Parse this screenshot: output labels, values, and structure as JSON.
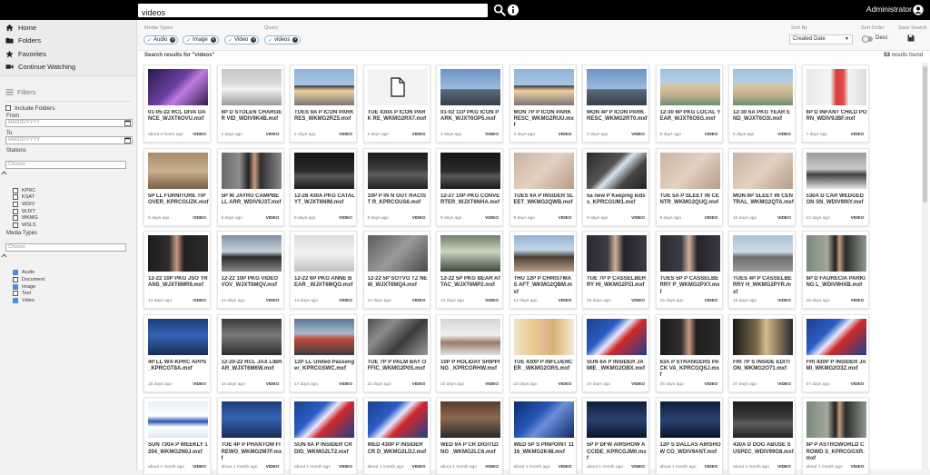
{
  "search": {
    "value": "videos"
  },
  "user": {
    "name": "Administrator"
  },
  "nav": [
    {
      "label": "Home",
      "icon": "home-icon"
    },
    {
      "label": "Folders",
      "icon": "folder-icon"
    },
    {
      "label": "Favorites",
      "icon": "star-icon"
    },
    {
      "label": "Continue Watching",
      "icon": "video-camera-icon"
    }
  ],
  "filters": {
    "title": "Filters",
    "include_folders": "Include Folders",
    "from_label": "From",
    "from_placeholder": "MM/DD/YYYY",
    "to_label": "To",
    "to_placeholder": "MM/DD/YYYY",
    "stations_label": "Stations",
    "stations_placeholder": "Choose",
    "stations": [
      "KPRC",
      "KSAT",
      "WDIV",
      "WJXT",
      "WKMG",
      "WSLS"
    ],
    "media_types_label": "Media Types",
    "media_types_placeholder": "Choose",
    "media_types": [
      {
        "label": "Audio",
        "checked": true
      },
      {
        "label": "Document",
        "checked": false
      },
      {
        "label": "Image",
        "checked": true
      },
      {
        "label": "Text",
        "checked": false
      },
      {
        "label": "Video",
        "checked": true
      }
    ]
  },
  "filterbar": {
    "media_types_label": "Media Types",
    "query_label": "Query",
    "chips": [
      "Audio",
      "Image",
      "Video"
    ],
    "query_chip": "videos",
    "sort_by_label": "Sort By",
    "sort_by_value": "Created Date",
    "sort_order_label": "Sort Order",
    "sort_order_value": "Desc",
    "save_search_label": "Save Search"
  },
  "results": {
    "heading": "Search results for \"videos\"",
    "count": "53",
    "count_suffix": "results found"
  },
  "cards": [
    {
      "title": "01-05-22 RCL DIVA DANCE_WJXT6OVU.mxf",
      "age": "about 2 hours ago",
      "type": "VIDEO",
      "thumb": "purple"
    },
    {
      "title": "6P D STOLEN CHARGER VID_WDIV9K4B.mxf",
      "age": "2 days ago",
      "type": "VIDEO",
      "thumb": "car-white"
    },
    {
      "title": "TUES 9A P ICON PARK RES_WKMG2RZ5.mxf",
      "age": "2 days ago",
      "type": "VIDEO",
      "thumb": "reporter-sky"
    },
    {
      "title": "TUE 430A P ICON PARK RE_WKMG2RX7.mxf",
      "age": "2 days ago",
      "type": "VIDEO",
      "thumb": "doc"
    },
    {
      "title": "01-02 11P PKG ICON PARK_WJXT6OP5.mxf",
      "age": "3 days ago",
      "type": "VIDEO",
      "thumb": "wheel"
    },
    {
      "title": "MON 7P P ICON PARK RESC_WKMG2RUU.mxf",
      "age": "3 days ago",
      "type": "VIDEO",
      "thumb": "reporter-sky"
    },
    {
      "title": "MON 4P P ICON PARK RESC_WKMG2RT0.mxf",
      "age": "3 days ago",
      "type": "VIDEO",
      "thumb": "wheel"
    },
    {
      "title": "12-30 6P PKG LOCAL YEAR_WJXT6O5G.mxf",
      "age": "5 days ago",
      "type": "VIDEO",
      "thumb": "buildings"
    },
    {
      "title": "12-30 6A PKG YEAR END_WJXT6O3I.mxf",
      "age": "5 days ago",
      "type": "VIDEO",
      "thumb": "buildings"
    },
    {
      "title": "6P D INFANT CHILD PORN_WDIV9JBF.mxf",
      "age": "7 days ago",
      "type": "VIDEO",
      "thumb": "red-person"
    },
    {
      "title": "5P LL FURNITURE TIPOVER_KPRCGUZK.mxf",
      "age": "8 days ago",
      "type": "VIDEO",
      "thumb": "furniture"
    },
    {
      "title": "5P W JAYRU CAMPBELL ARR_WDIV9J3T.mxf",
      "age": "8 days ago",
      "type": "VIDEO",
      "thumb": "woman-street"
    },
    {
      "title": "12-28 430A PKG CATALYT_WJXT6NIM.mxf",
      "age": "8 days ago",
      "type": "VIDEO",
      "thumb": "night-car"
    },
    {
      "title": "10P P IN N OUT RACIST R_KPRCGUS6.mxf",
      "age": "8 days ago",
      "type": "VIDEO",
      "thumb": "night-people"
    },
    {
      "title": "12-27 10P PKG CONVERTER_WJXT6NHA.mxf",
      "age": "9 days ago",
      "type": "VIDEO",
      "thumb": "night-car"
    },
    {
      "title": "TUES 9A P INSIDER SLEET_WKMG2QWB.mxf",
      "age": "9 days ago",
      "type": "VIDEO",
      "thumb": "blur-skin"
    },
    {
      "title": "5a new P Keeping kids s_KPRCGUM1.mxf",
      "age": "9 days ago",
      "type": "VIDEO",
      "thumb": "phone"
    },
    {
      "title": "TUE 5A P SLEET IN CENTR_WKMG2QUQ.mxf",
      "age": "9 days ago",
      "type": "VIDEO",
      "thumb": "blur-skin"
    },
    {
      "title": "MON 6P SLEET IN CENTRAL_WKMG2QTA.mxf",
      "age": "10 days ago",
      "type": "VIDEO",
      "thumb": "blur-skin"
    },
    {
      "title": "530A D CAR WEDGED ON SN_WDIV9INY.mxf",
      "age": "13 days ago",
      "type": "VIDEO",
      "thumb": "snow-car"
    },
    {
      "title": "12-22 10P PKG JSO TRANS_WJXT6MR9.mxf",
      "age": "13 days ago",
      "type": "VIDEO",
      "thumb": "woman-dark"
    },
    {
      "title": "12-22 10P PKG VIDEO VOV_WJXT6MQV.mxf",
      "age": "14 days ago",
      "type": "VIDEO",
      "thumb": "office"
    },
    {
      "title": "12-22 6P PKG ANNE BEAR _WJXT6MQO.mxf",
      "age": "14 days ago",
      "type": "VIDEO",
      "thumb": "paper"
    },
    {
      "title": "12-22 5P SOTVO TZ NEW_WJXT6MQ4.mxf",
      "age": "14 days ago",
      "type": "VIDEO",
      "thumb": "cctv"
    },
    {
      "title": "12-22 5P PKG BEAR ATTAC_WJXT6MP2.mxf",
      "age": "14 days ago",
      "type": "VIDEO",
      "thumb": "window"
    },
    {
      "title": "THU 12P P CHRISTMAS AFT_WKMG2QBM.mxf",
      "age": "14 days ago",
      "type": "VIDEO",
      "thumb": "crowd"
    },
    {
      "title": "TUE 7P P CASSELBERRY HI_WKMG2PZI.mxf",
      "age": "16 days ago",
      "type": "VIDEO",
      "thumb": "officer"
    },
    {
      "title": "TUES 5P P CASSELBERRY P_WKMG2PXY.mxf",
      "age": "16 days ago",
      "type": "VIDEO",
      "thumb": "officer"
    },
    {
      "title": "TUES 4P P CASSELBERRY H_WKMG2PYR.mxf",
      "age": "16 days ago",
      "type": "VIDEO",
      "thumb": "road"
    },
    {
      "title": "6P D FAURECIA PARKING L_WDIV9HXB.mxf",
      "age": "16 days ago",
      "type": "VIDEO",
      "thumb": "man-outdoor"
    },
    {
      "title": "4P LL WX-KPRC APPS_KPRCGT8A.mxf",
      "age": "16 days ago",
      "type": "VIDEO",
      "thumb": "studio-blue"
    },
    {
      "title": "12-20-22 RCL JAX LIBRAR_WJXT6M6W.mxf",
      "age": "16 days ago",
      "type": "VIDEO",
      "thumb": "library"
    },
    {
      "title": "12P LL United Passenger_KPRCGSWC.mxf",
      "age": "17 days ago",
      "type": "VIDEO",
      "thumb": "airport"
    },
    {
      "title": "TUE 7P P PALM BAY OFFIC_WKMG2P0S.mxf",
      "age": "22 days ago",
      "type": "VIDEO",
      "thumb": "aerial"
    },
    {
      "title": "10P P HOLIDAY SHIPPING _KPRCGRHW.mxf",
      "age": "22 days ago",
      "type": "VIDEO",
      "thumb": "mall"
    },
    {
      "title": "TUE 430P P INFLUENCER _WKMG2ORS.mxf",
      "age": "23 days ago",
      "type": "VIDEO",
      "thumb": "blonde"
    },
    {
      "title": "SUN 6A P INSIDER JAMIE _WKMG2OBX.mxf",
      "age": "24 days ago",
      "type": "VIDEO",
      "thumb": "news-6"
    },
    {
      "title": "63A P STRANGERS PACK VA_KPRCGQSJ.mxf",
      "age": "25 days ago",
      "type": "VIDEO",
      "thumb": "woman-dark"
    },
    {
      "title": "FRI 7P S INSIDE EDITION_WKMG2O71.mxf",
      "age": "27 days ago",
      "type": "VIDEO",
      "thumb": "blur-dark"
    },
    {
      "title": "FRI 430P P INSIDER JAMI_WKMG2O3Z.mxf",
      "age": "27 days ago",
      "type": "VIDEO",
      "thumb": "news-6"
    },
    {
      "title": "SUN 730A P WEEKLY 1204_WKMG2N0J.mxf",
      "age": "about 1 month ago",
      "type": "VIDEO",
      "thumb": "weekly"
    },
    {
      "title": "TUE 4P P PHANTOM FIREWO_WKMG2M7F.mxf",
      "age": "about 1 month ago",
      "type": "VIDEO",
      "thumb": "studio-blue"
    },
    {
      "title": "SUN 6A P INSIDER CR DIG_WKMG2LT2.mxf",
      "age": "about 1 month ago",
      "type": "VIDEO",
      "thumb": "news-6"
    },
    {
      "title": "WED 430P P INSIDER CR D_WKMG2LDJ.mxf",
      "age": "about 1 month ago",
      "type": "VIDEO",
      "thumb": "news-6"
    },
    {
      "title": "WED 9A P CR DIGITIZING _WKMG2LC6.mxf",
      "age": "about 1 month ago",
      "type": "VIDEO",
      "thumb": "desk"
    },
    {
      "title": "WED 5P S PINPOINT 1116_WKMG2K48.mxf",
      "age": "about 1 month ago",
      "type": "VIDEO",
      "thumb": "radar"
    },
    {
      "title": "5P P DFW AIRSHOW ACCIDE_KPRCGJM0.mxf",
      "age": "about 1 month ago",
      "type": "VIDEO",
      "thumb": "sky-dark"
    },
    {
      "title": "12P S DALLAS AIRSHOW CO_WDIV9ANT.mxf",
      "age": "about 1 month ago",
      "type": "VIDEO",
      "thumb": "sky-dark"
    },
    {
      "title": "430A D DOG ABUSE SUSPEC_WDIV99G8.mxf",
      "age": "about 1 month ago",
      "type": "VIDEO",
      "thumb": "night-people"
    },
    {
      "title": "6P P ASTROWORLD CROWD S_KPRCGGXR.mxf",
      "age": "about 1 month ago",
      "type": "VIDEO",
      "thumb": "man-outdoor"
    }
  ]
}
